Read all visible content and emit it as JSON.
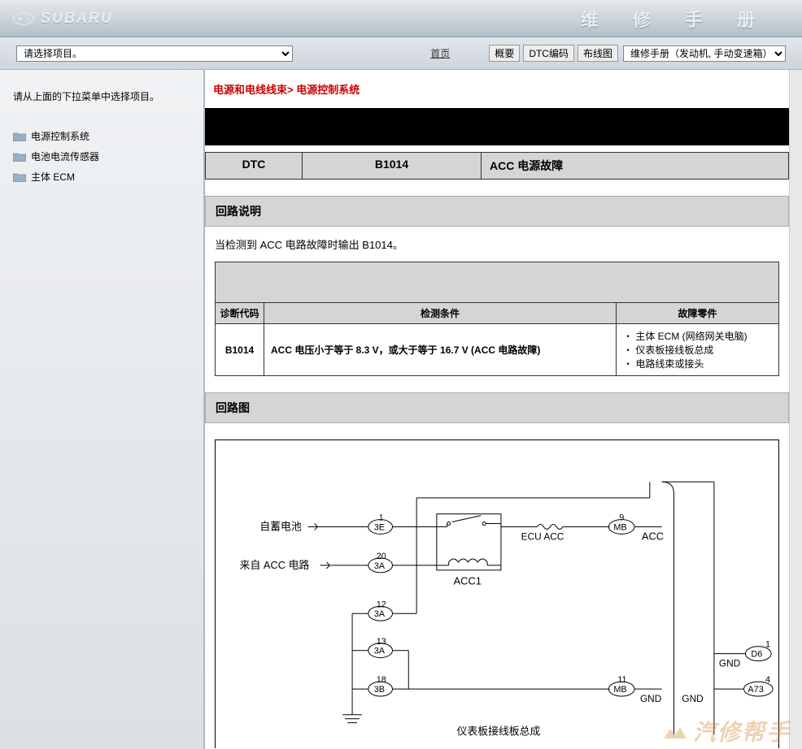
{
  "header": {
    "brand": "SUBARU",
    "title": "维 修 手 册"
  },
  "toolbar": {
    "project_select": "请选择项目。",
    "home": "首页",
    "btn_summary": "概要",
    "btn_dtc": "DTC编码",
    "btn_wiring": "布线图",
    "manual_select": "维修手册（发动机, 手动变速箱）"
  },
  "sidebar": {
    "hint": "请从上面的下拉菜单中选择项目。",
    "items": [
      "电源控制系统",
      "电池电流传感器",
      "主体 ECM"
    ]
  },
  "content": {
    "breadcrumb": "电源和电线线束> 电源控制系统",
    "dtc": {
      "label": "DTC",
      "code": "B1014",
      "title": "ACC 电源故障"
    },
    "section1": {
      "header": "回路说明",
      "desc": "当检测到 ACC 电路故障时输出 B1014。",
      "table": {
        "headers": [
          "诊断代码",
          "检测条件",
          "故障零件"
        ],
        "row": {
          "code": "B1014",
          "cond": "ACC 电压小于等于 8.3 V，或大于等于 16.7 V (ACC 电路故障)",
          "parts": [
            "主体 ECM (网络网关电脑)",
            "仪表板接线板总成",
            "电路线束或接头"
          ]
        }
      }
    },
    "section2": {
      "header": "回路图"
    },
    "diagram": {
      "from_battery": "自蓄电池",
      "from_acc": "来自 ACC 电路",
      "ecu_acc": "ECU ACC",
      "acc1": "ACC1",
      "acc_label": "ACC",
      "gnd": "GND",
      "bottom_label": "仪表板接线板总成",
      "pins": {
        "p1": {
          "num": "1",
          "id": "3E"
        },
        "p2": {
          "num": "20",
          "id": "3A"
        },
        "p3": {
          "num": "12",
          "id": "3A"
        },
        "p4": {
          "num": "13",
          "id": "3A"
        },
        "p5": {
          "num": "18",
          "id": "3B"
        },
        "p6": {
          "num": "9",
          "id": "MB"
        },
        "p7": {
          "num": "11",
          "id": "MB"
        },
        "p8": {
          "num": "1",
          "id": "D6"
        },
        "p9": {
          "num": "4",
          "id": "A73"
        }
      }
    }
  },
  "watermark": "汽修帮手"
}
